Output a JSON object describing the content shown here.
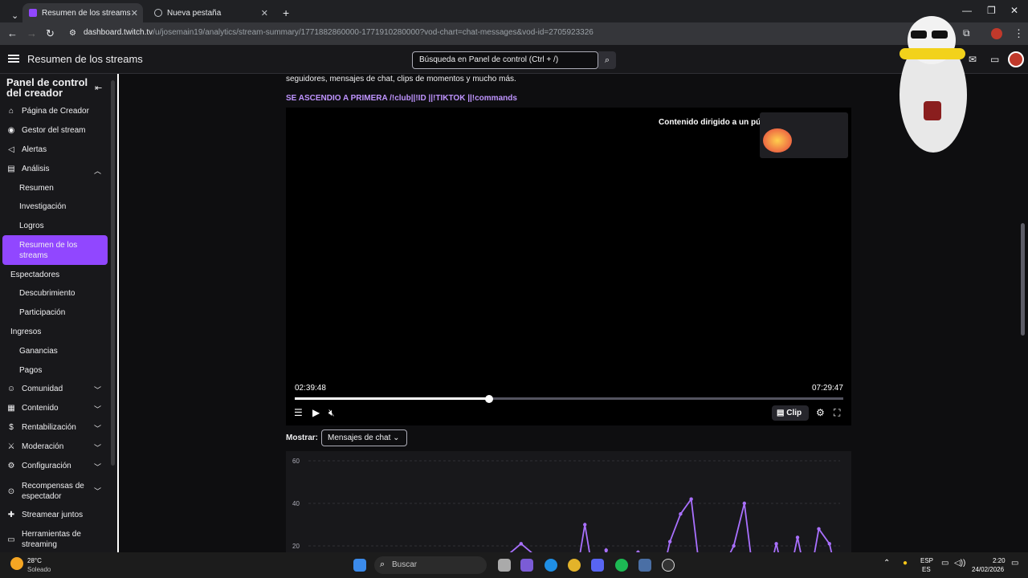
{
  "browser": {
    "tabs": [
      {
        "title": "Resumen de los streams - Twitch",
        "active": true
      },
      {
        "title": "Nueva pestaña",
        "active": false
      }
    ],
    "url_domain": "dashboard.twitch.tv",
    "url_path": "/u/josemain19/analytics/stream-summary/1771882860000-1771910280000?vod-chart=chat-messages&vod-id=2705923326"
  },
  "header": {
    "title": "Resumen de los streams",
    "search_placeholder": "Búsqueda en Panel de control (Ctrl + /)"
  },
  "sidebar": {
    "title": "Panel de control del creador",
    "items": {
      "pagina_creador": "Página de Creador",
      "gestor": "Gestor del stream",
      "alertas": "Alertas",
      "analisis": "Análisis",
      "resumen": "Resumen",
      "investigacion": "Investigación",
      "logros": "Logros",
      "resumen_streams": "Resumen de los streams",
      "espectadores": "Espectadores",
      "descubrimiento": "Descubrimiento",
      "participacion": "Participación",
      "ingresos": "Ingresos",
      "ganancias": "Ganancias",
      "pagos": "Pagos",
      "comunidad": "Comunidad",
      "contenido": "Contenido",
      "rentabilizacion": "Rentabilización",
      "moderacion": "Moderación",
      "configuracion": "Configuración",
      "recompensas": "Recompensas de espectador",
      "streamear": "Streamear juntos",
      "herramientas": "Herramientas de streaming"
    }
  },
  "main": {
    "description": "seguidores, mensajes de chat, clips de momentos y mucho más.",
    "commands": "SE ASCENDIO A PRIMERA /!club||!ID ||!TIKTOK ||!commands",
    "audience_label": "Contenido dirigido a un público concreto.",
    "time_current": "02:39:48",
    "time_total": "07:29:47",
    "progress": 0.354,
    "clip_label": "Clip",
    "show_label": "Mostrar:",
    "show_value": "Mensajes de chat"
  },
  "chart_data": {
    "type": "line",
    "series": [
      {
        "color": "#a970ff",
        "x": [
          0,
          10,
          20,
          30,
          40,
          50,
          52,
          54,
          56,
          58,
          60,
          62,
          64,
          66,
          68,
          70,
          72,
          74,
          76,
          80,
          82,
          84,
          86,
          88,
          90,
          92,
          94,
          96,
          98,
          100
        ],
        "values": [
          0,
          0,
          0,
          0,
          21,
          0,
          30,
          0,
          18,
          0,
          0,
          17,
          0,
          0,
          22,
          35,
          42,
          0,
          0,
          20,
          40,
          0,
          0,
          21,
          0,
          24,
          0,
          28,
          21,
          0
        ]
      }
    ],
    "y_ticks": [
      "60",
      "40",
      "20"
    ],
    "ylim": [
      0,
      60
    ]
  },
  "taskbar": {
    "weather_temp": "28°C",
    "weather_desc": "Soleado",
    "search": "Buscar",
    "lang_top": "ESP",
    "lang_bottom": "ES",
    "time": "2:20",
    "date": "24/02/2026"
  },
  "colors": {
    "accent": "#9147ff",
    "chart_line": "#a970ff"
  }
}
